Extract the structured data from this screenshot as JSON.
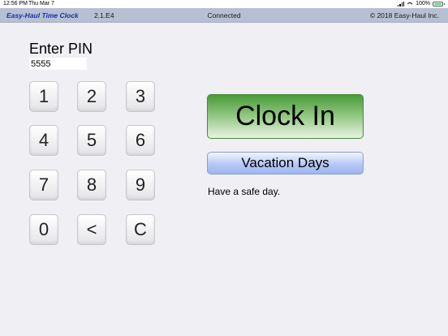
{
  "status_bar": {
    "time": "12:56 PM",
    "date": "Thu Mar 7",
    "battery": "100%"
  },
  "header": {
    "brand": "Easy-Haul Time Clock",
    "version": "2.1.E4",
    "connection": "Connected",
    "copyright": "© 2018 Easy-Haul Inc."
  },
  "pin": {
    "label": "Enter PIN",
    "value": "5555"
  },
  "keypad": [
    "1",
    "2",
    "3",
    "4",
    "5",
    "6",
    "7",
    "8",
    "9",
    "0",
    "<",
    "C"
  ],
  "actions": {
    "clock_in": "Clock In",
    "vacation_days": "Vacation Days"
  },
  "message": "Have a safe day.",
  "colors": {
    "header_bg": "#b6bfd3",
    "brand_text": "#1133aa",
    "clock_in_green": "#4a9a3a",
    "vacation_blue": "#9db5ef",
    "background": "#efeff4"
  }
}
